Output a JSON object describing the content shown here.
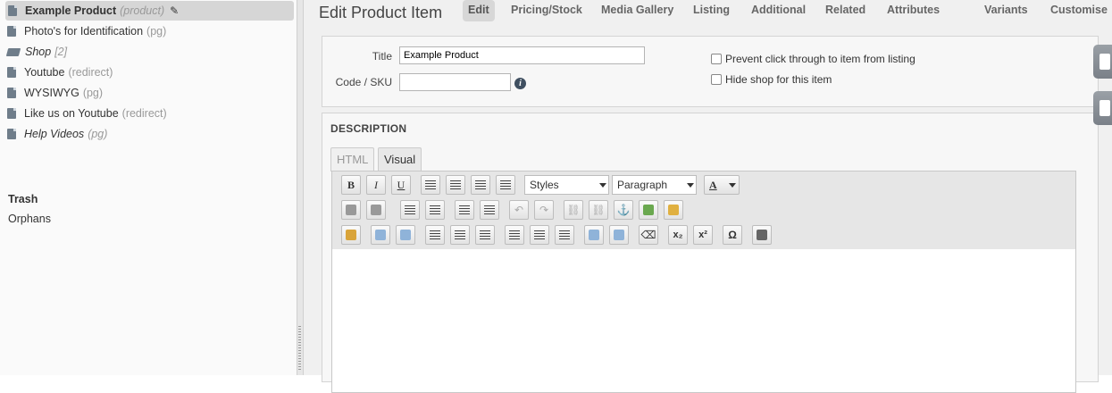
{
  "sidebar": {
    "items": [
      {
        "label": "Example Product",
        "note": "(product)"
      },
      {
        "label": "Photo's for Identification",
        "note": "(pg)"
      },
      {
        "label": "Shop",
        "note": "[2]"
      },
      {
        "label": "Youtube",
        "note": "(redirect)"
      },
      {
        "label": "WYSIWYG",
        "note": "(pg)"
      },
      {
        "label": "Like us on Youtube",
        "note": "(redirect)"
      },
      {
        "label": "Help Videos",
        "note": "(pg)"
      }
    ],
    "trash": "Trash",
    "orphans": "Orphans"
  },
  "header": {
    "title": "Edit Product Item",
    "tabs": [
      "Edit",
      "Pricing/Stock",
      "Media Gallery",
      "Listing",
      "Additional",
      "Related",
      "Attributes",
      "Variants",
      "Customise"
    ],
    "active_tab": "Edit"
  },
  "form": {
    "title_label": "Title",
    "title_value": "Example Product",
    "code_label": "Code / SKU",
    "code_value": "",
    "prevent_click_label": "Prevent click through to item from listing",
    "hide_shop_label": "Hide shop for this item"
  },
  "description": {
    "heading": "DESCRIPTION",
    "tabs": [
      "HTML",
      "Visual"
    ],
    "active_tab": "Visual",
    "styles_select": "Styles",
    "format_select": "Paragraph",
    "text_color_glyph": "A",
    "bold": "B",
    "italic": "I",
    "underline": "U",
    "omega": "Ω"
  },
  "colors": {
    "accent": "#3f4f60"
  }
}
